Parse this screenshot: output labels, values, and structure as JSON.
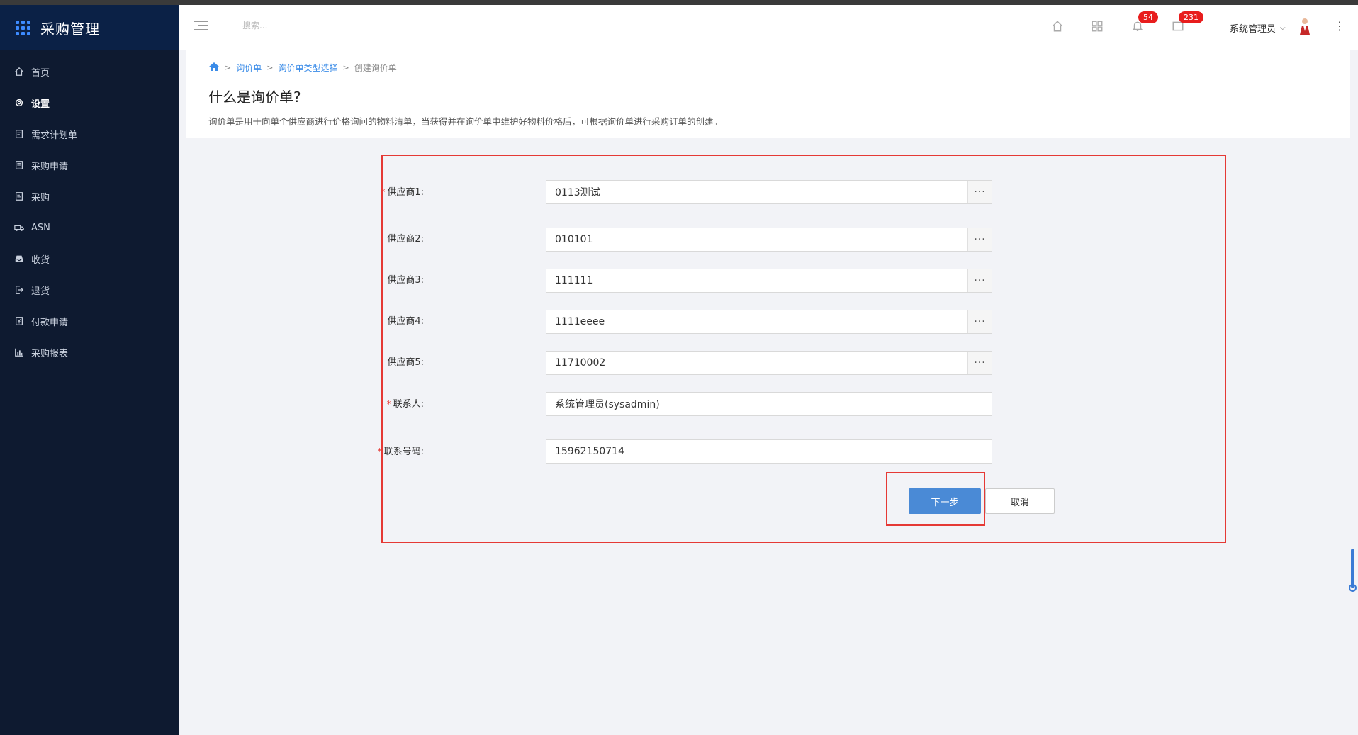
{
  "app": {
    "title": "采购管理"
  },
  "sidebar": {
    "items": [
      {
        "label": "首页",
        "icon": "home-icon"
      },
      {
        "label": "设置",
        "icon": "gear-icon",
        "active": true
      },
      {
        "label": "需求计划单",
        "icon": "clipboard-icon"
      },
      {
        "label": "采购申请",
        "icon": "document-icon"
      },
      {
        "label": "采购",
        "icon": "list-icon"
      },
      {
        "label": "ASN",
        "icon": "truck-icon"
      },
      {
        "label": "收货",
        "icon": "inbox-icon"
      },
      {
        "label": "退货",
        "icon": "return-icon"
      },
      {
        "label": "付款申请",
        "icon": "payment-icon"
      },
      {
        "label": "采购报表",
        "icon": "bar-chart-icon"
      }
    ]
  },
  "header": {
    "search_placeholder": "搜索...",
    "notifications_count": "54",
    "messages_count": "231",
    "user_name": "系统管理员",
    "accent_color": "#0b2146"
  },
  "breadcrumb": {
    "items": [
      "询价单",
      "询价单类型选择",
      "创建询价单"
    ]
  },
  "page": {
    "title": "什么是询价单?",
    "description": "询价单是用于向单个供应商进行价格询问的物料清单，当获得并在询价单中维护好物料价格后，可根据询价单进行采购订单的创建。"
  },
  "form": {
    "fields": [
      {
        "label": "供应商1:",
        "value": "0113测试",
        "required": true,
        "lookup": true
      },
      {
        "label": "供应商2:",
        "value": "010101",
        "required": false,
        "lookup": true
      },
      {
        "label": "供应商3:",
        "value": "111111",
        "required": false,
        "lookup": true
      },
      {
        "label": "供应商4:",
        "value": "1111eeee",
        "required": false,
        "lookup": true
      },
      {
        "label": "供应商5:",
        "value": "11710002",
        "required": false,
        "lookup": true
      },
      {
        "label": "联系人:",
        "value": "系统管理员(sysadmin)",
        "required": true,
        "lookup": false
      },
      {
        "label": "联系号码:",
        "value": "15962150714",
        "required": true,
        "lookup": false
      }
    ],
    "next_label": "下一步",
    "cancel_label": "取消",
    "highlight_color": "#e53935"
  }
}
